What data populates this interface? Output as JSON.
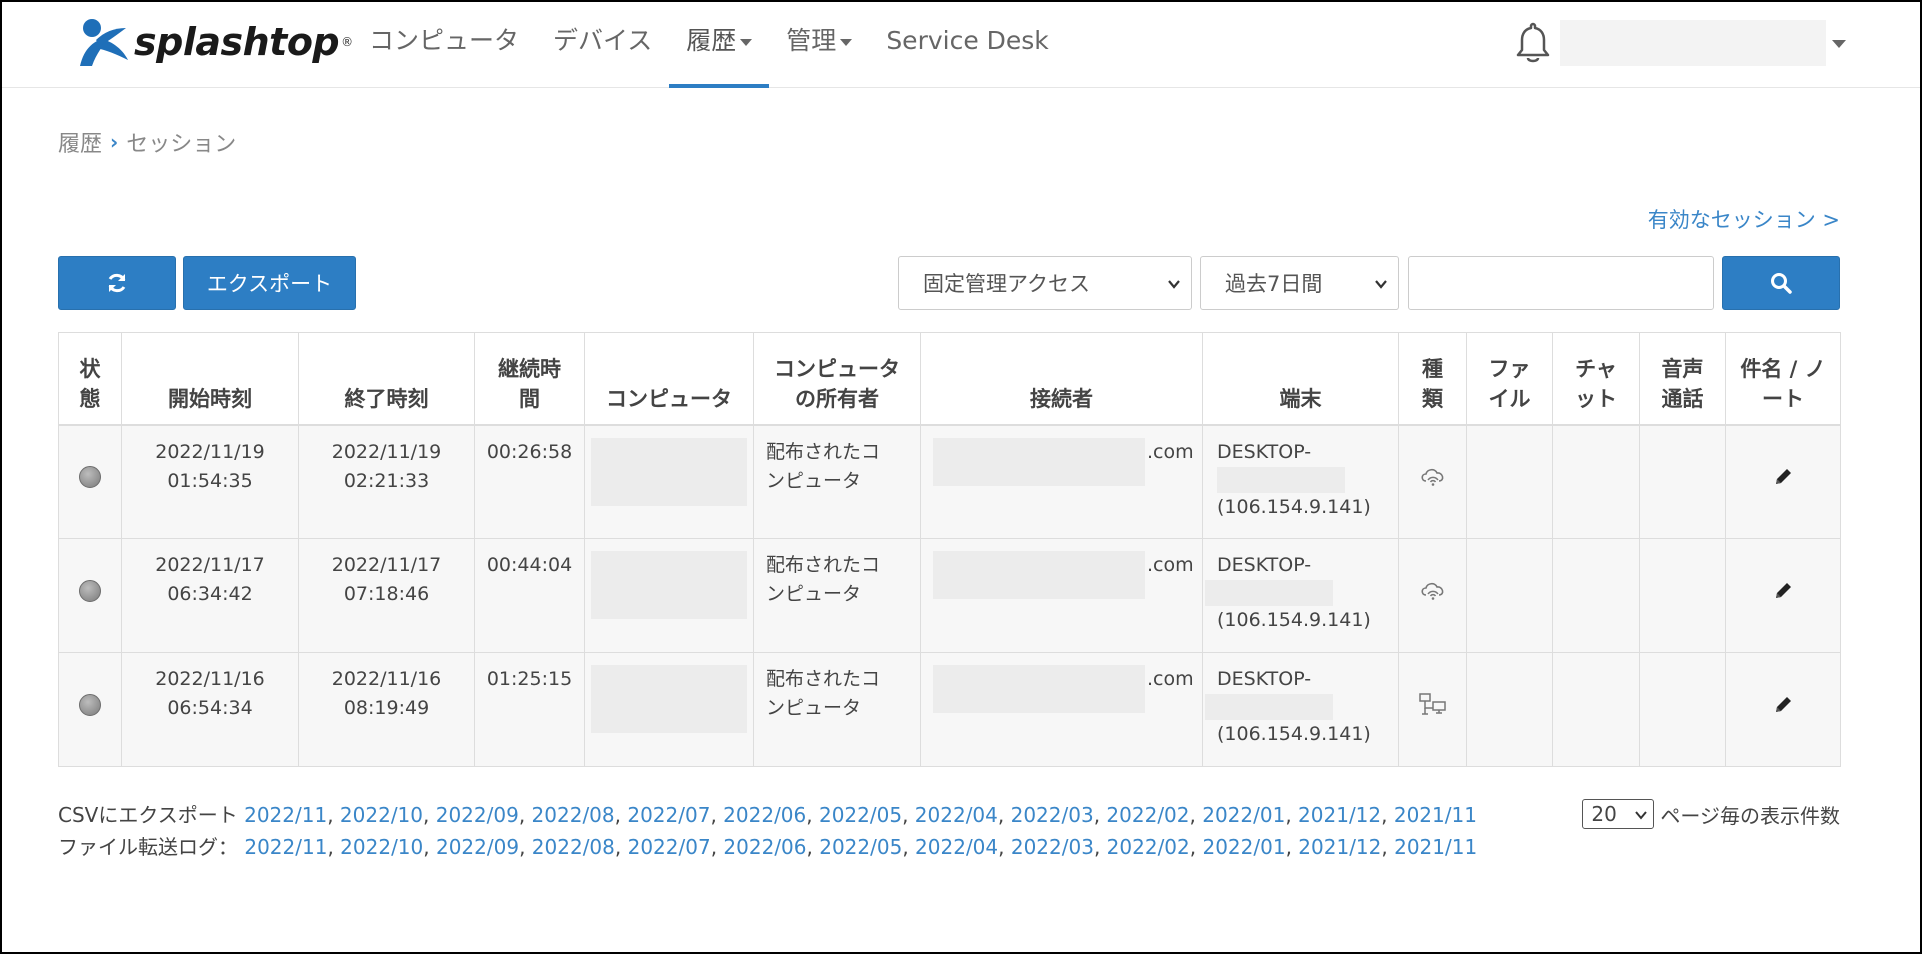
{
  "header": {
    "brand": "splashtop",
    "nav": [
      {
        "label": "コンピュータ",
        "dropdown": false,
        "active": false
      },
      {
        "label": "デバイス",
        "dropdown": false,
        "active": false
      },
      {
        "label": "履歴",
        "dropdown": true,
        "active": true
      },
      {
        "label": "管理",
        "dropdown": true,
        "active": false
      },
      {
        "label": "Service Desk",
        "dropdown": false,
        "active": false
      }
    ]
  },
  "breadcrumb": {
    "parent": "履歴",
    "current": "セッション"
  },
  "active_sessions_link": "有効なセッション >",
  "toolbar": {
    "export_label": "エクスポート",
    "type_filter": "固定管理アクセス",
    "period_filter": "過去7日間",
    "search_value": ""
  },
  "table": {
    "headers": {
      "status": [
        "状",
        "態"
      ],
      "start": "開始時刻",
      "end": "終了時刻",
      "duration": [
        "継続時",
        "間"
      ],
      "computer": "コンピュータ",
      "owner": [
        "コンピュータ",
        "の所有者"
      ],
      "connector": "接続者",
      "device": "端末",
      "kind": [
        "種",
        "類"
      ],
      "file": [
        "ファ",
        "イル"
      ],
      "chat": [
        "チャ",
        "ット"
      ],
      "voice": [
        "音声",
        "通話"
      ],
      "note": [
        "件名 / ノ",
        "ート"
      ]
    },
    "rows": [
      {
        "start_date": "2022/11/19",
        "start_time": "01:54:35",
        "end_date": "2022/11/19",
        "end_time": "02:21:33",
        "duration": "00:26:58",
        "owner_line1": "配布されたコ",
        "owner_line2": "ンピュータ",
        "connector_suffix": ".com",
        "device_name": "DESKTOP-",
        "device_ip": "(106.154.9.141)",
        "kind_icon": "cloud-icon"
      },
      {
        "start_date": "2022/11/17",
        "start_time": "06:34:42",
        "end_date": "2022/11/17",
        "end_time": "07:18:46",
        "duration": "00:44:04",
        "owner_line1": "配布されたコ",
        "owner_line2": "ンピュータ",
        "connector_suffix": ".com",
        "device_name": "DESKTOP-",
        "device_ip": "(106.154.9.141)",
        "kind_icon": "cloud-icon"
      },
      {
        "start_date": "2022/11/16",
        "start_time": "06:54:34",
        "end_date": "2022/11/16",
        "end_time": "08:19:49",
        "duration": "01:25:15",
        "owner_line1": "配布されたコ",
        "owner_line2": "ンピュータ",
        "connector_suffix": ".com",
        "device_name": "DESKTOP-",
        "device_ip": "(106.154.9.141)",
        "kind_icon": "network-icon"
      }
    ]
  },
  "footer": {
    "csv_label": "CSVにエクスポート",
    "file_log_label": "ファイル転送ログ：",
    "months": [
      "2022/11",
      "2022/10",
      "2022/09",
      "2022/08",
      "2022/07",
      "2022/06",
      "2022/05",
      "2022/04",
      "2022/03",
      "2022/02",
      "2022/01",
      "2021/12",
      "2021/11"
    ],
    "per_page_value": "20",
    "per_page_label": "ページ毎の表示件数"
  },
  "colors": {
    "accent": "#2d7ec4",
    "link": "#3a86c8",
    "row_bg": "#f7f7f7",
    "border": "#dddddd"
  }
}
